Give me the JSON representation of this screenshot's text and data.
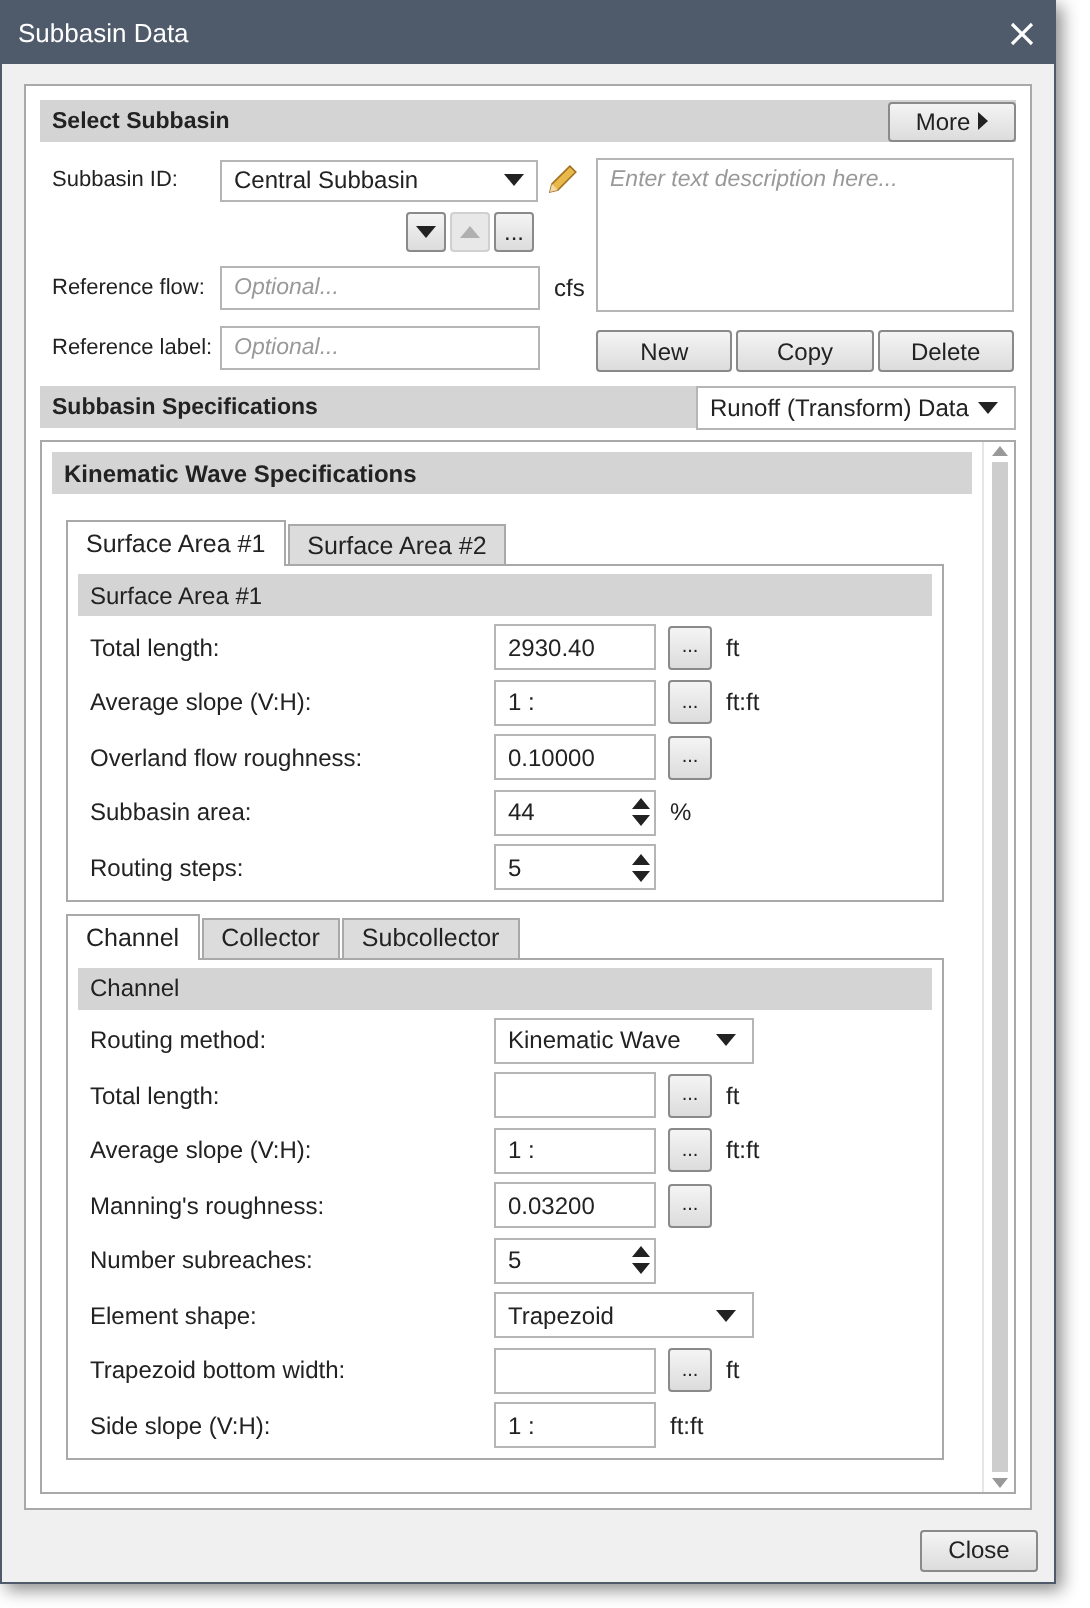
{
  "window": {
    "title": "Subbasin Data"
  },
  "select_subbasin": {
    "title": "Select Subbasin",
    "more_button": "More",
    "subbasin_id": {
      "label": "Subbasin ID:",
      "value": "Central Subbasin"
    },
    "nav_buttons": [
      {
        "kind": "down",
        "disabled": false
      },
      {
        "kind": "up",
        "disabled": true
      },
      {
        "kind": "browse",
        "label": "...",
        "disabled": false
      }
    ],
    "reference_flow": {
      "label": "Reference flow:",
      "placeholder": "Optional...",
      "unit": "cfs"
    },
    "reference_label": {
      "label": "Reference label:",
      "placeholder": "Optional..."
    },
    "description": {
      "placeholder": "Enter text description here..."
    },
    "buttons": [
      "New",
      "Copy",
      "Delete"
    ]
  },
  "specifications": {
    "title": "Subbasin Specifications",
    "view": "Runoff (Transform) Data",
    "section_title": "Kinematic Wave Specifications",
    "tab_groups": [
      {
        "tabs": [
          {
            "label": "Surface Area #1",
            "selected": true
          },
          {
            "label": "Surface Area #2",
            "selected": false
          }
        ],
        "panel_title": "Surface Area #1",
        "rows": [
          {
            "kind": "input",
            "label": "Total length:",
            "value": "2930.40",
            "browse": "...",
            "unit": "ft"
          },
          {
            "kind": "input",
            "label": "Average slope (V:H):",
            "value": "1 :",
            "browse": "...",
            "unit": "ft:ft"
          },
          {
            "kind": "input",
            "label": "Overland flow roughness:",
            "value": "0.10000",
            "browse": "..."
          },
          {
            "kind": "spin",
            "label": "Subbasin area:",
            "value": "44",
            "unit": "%"
          },
          {
            "kind": "spin",
            "label": "Routing steps:",
            "value": "5"
          }
        ]
      },
      {
        "tabs": [
          {
            "label": "Channel",
            "selected": true
          },
          {
            "label": "Collector",
            "selected": false
          },
          {
            "label": "Subcollector",
            "selected": false
          }
        ],
        "panel_title": "Channel",
        "rows": [
          {
            "kind": "select",
            "label": "Routing method:",
            "value": "Kinematic Wave"
          },
          {
            "kind": "input",
            "label": "Total length:",
            "browse": "...",
            "unit": "ft"
          },
          {
            "kind": "input",
            "label": "Average slope (V:H):",
            "value": "1 :",
            "browse": "...",
            "unit": "ft:ft"
          },
          {
            "kind": "input",
            "label": "Manning's roughness:",
            "value": "0.03200",
            "browse": "..."
          },
          {
            "kind": "spin",
            "label": "Number subreaches:",
            "value": "5"
          },
          {
            "kind": "select",
            "label": "Element shape:",
            "value": "Trapezoid"
          },
          {
            "kind": "input",
            "label": "Trapezoid bottom width:",
            "browse": "...",
            "unit": "ft"
          },
          {
            "kind": "input",
            "label": "Side slope (V:H):",
            "value": "1 :",
            "unit": "ft:ft"
          }
        ]
      }
    ]
  },
  "footer": {
    "close_button": "Close"
  }
}
